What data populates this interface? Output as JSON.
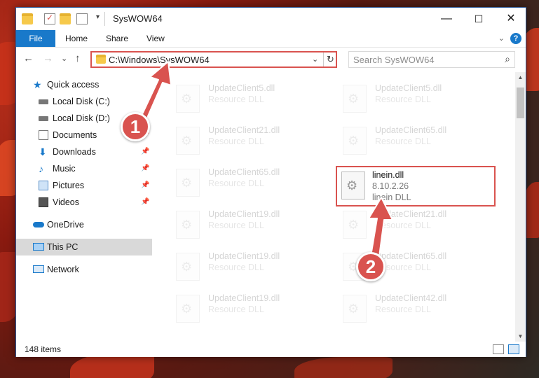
{
  "window": {
    "title": "SysWOW64",
    "minimize": "—",
    "maximize": "☐",
    "close": "✕"
  },
  "ribbon": {
    "file": "File",
    "home": "Home",
    "share": "Share",
    "view": "View",
    "help": "?"
  },
  "nav": {
    "back": "←",
    "forward": "→",
    "recent": "⌄",
    "up": "↑",
    "address": "C:\\Windows\\SysWOW64",
    "refresh": "↻",
    "search_placeholder": "Search SysWOW64",
    "search_icon": "⌕"
  },
  "sidebar": {
    "items": [
      {
        "label": "Quick access",
        "icon": "star-icon",
        "pinned": false
      },
      {
        "label": "Local Disk (C:)",
        "icon": "drive-icon",
        "pinned": false
      },
      {
        "label": "Local Disk (D:)",
        "icon": "drive-icon",
        "pinned": false
      },
      {
        "label": "Documents",
        "icon": "documents-icon",
        "pinned": true
      },
      {
        "label": "Downloads",
        "icon": "downloads-icon",
        "pinned": true
      },
      {
        "label": "Music",
        "icon": "music-icon",
        "pinned": true
      },
      {
        "label": "Pictures",
        "icon": "pictures-icon",
        "pinned": true
      },
      {
        "label": "Videos",
        "icon": "videos-icon",
        "pinned": true
      },
      {
        "label": "OneDrive",
        "icon": "cloud-icon",
        "pinned": false
      },
      {
        "label": "This PC",
        "icon": "computer-icon",
        "pinned": false,
        "selected": true
      },
      {
        "label": "Network",
        "icon": "network-icon",
        "pinned": false
      }
    ],
    "pin_glyph": "📌"
  },
  "files": {
    "left": [
      {
        "name": "UpdateClient5.dll",
        "desc": "Resource DLL"
      },
      {
        "name": "UpdateClient21.dll",
        "desc": "Resource DLL"
      },
      {
        "name": "UpdateClient65.dll",
        "desc": "Resource DLL"
      },
      {
        "name": "UpdateClient19.dll",
        "desc": "Resource DLL"
      },
      {
        "name": "UpdateClient19.dll",
        "desc": "Resource DLL"
      },
      {
        "name": "UpdateClient19.dll",
        "desc": "Resource DLL"
      }
    ],
    "right": [
      {
        "name": "UpdateClient5.dll",
        "desc": "Resource DLL"
      },
      {
        "name": "UpdateClient65.dll",
        "desc": "Resource DLL"
      },
      {
        "name": "linein.dll",
        "version": "8.10.2.26",
        "desc": "linein DLL",
        "highlighted": true
      },
      {
        "name": "UpdateClient21.dll",
        "desc": "Resource DLL"
      },
      {
        "name": "UpdateClient65.dll",
        "desc": "Resource DLL"
      },
      {
        "name": "UpdateClient42.dll",
        "desc": "Resource DLL"
      }
    ]
  },
  "status": {
    "count": "148 items"
  },
  "annotations": {
    "badge1": "1",
    "badge2": "2",
    "color": "#d9534f"
  }
}
